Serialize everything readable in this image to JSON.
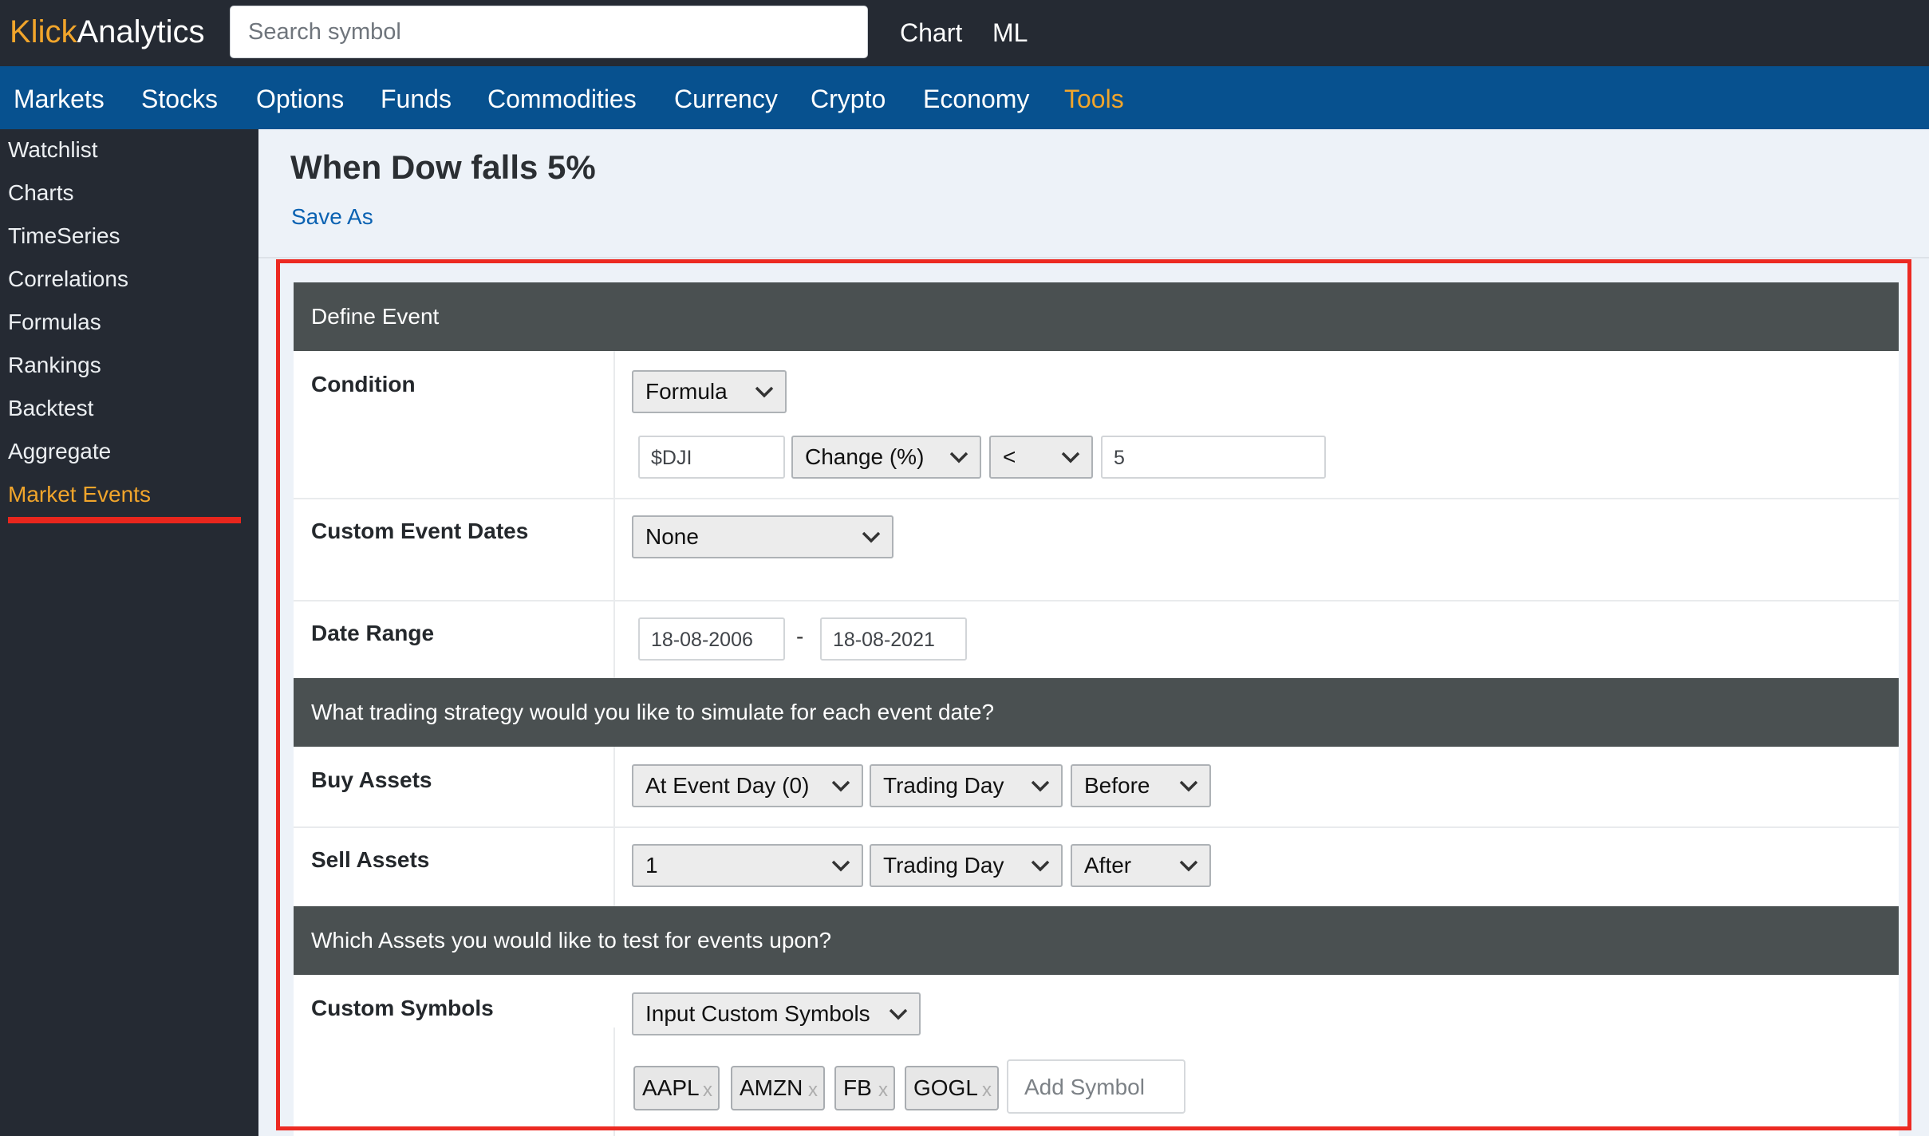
{
  "topbar": {
    "logo_part1": "Klick",
    "logo_part2": "Analytics",
    "search_placeholder": "Search symbol",
    "links": [
      "Chart",
      "ML"
    ]
  },
  "nav": {
    "items": [
      "Markets",
      "Stocks",
      "Options",
      "Funds",
      "Commodities",
      "Currency",
      "Crypto",
      "Economy",
      "Tools"
    ],
    "active": "Tools"
  },
  "sidebar": {
    "items": [
      "Watchlist",
      "Charts",
      "TimeSeries",
      "Correlations",
      "Formulas",
      "Rankings",
      "Backtest",
      "Aggregate",
      "Market Events"
    ],
    "active": "Market Events"
  },
  "page": {
    "title": "When Dow falls 5%",
    "save_as": "Save As"
  },
  "form": {
    "section1": "Define Event",
    "condition": {
      "label": "Condition",
      "type": "Formula",
      "symbol": "$DJI",
      "metric": "Change (%)",
      "operator": "<",
      "value": "5"
    },
    "custom_dates": {
      "label": "Custom Event Dates",
      "value": "None"
    },
    "date_range": {
      "label": "Date Range",
      "from": "18-08-2006",
      "separator": "-",
      "to": "18-08-2021"
    },
    "section2": "What trading strategy would you like to simulate for each event date?",
    "buy": {
      "label": "Buy Assets",
      "when": "At Event Day (0)",
      "unit": "Trading Day",
      "position": "Before"
    },
    "sell": {
      "label": "Sell Assets",
      "when": "1",
      "unit": "Trading Day",
      "position": "After"
    },
    "section3": "Which Assets you would like to test for events upon?",
    "symbols": {
      "label": "Custom Symbols",
      "mode": "Input Custom Symbols",
      "tags": [
        "AAPL",
        "AMZN",
        "FB",
        "GOGL"
      ],
      "tag_remove": "x",
      "add_placeholder": "Add Symbol"
    }
  },
  "colors": {
    "topbar_bg": "#252a33",
    "nav_bg": "#07518f",
    "accent": "#f1a52b",
    "link": "#0a62b2",
    "highlight_border": "#ec2a22",
    "section_header_bg": "#4a5051"
  }
}
